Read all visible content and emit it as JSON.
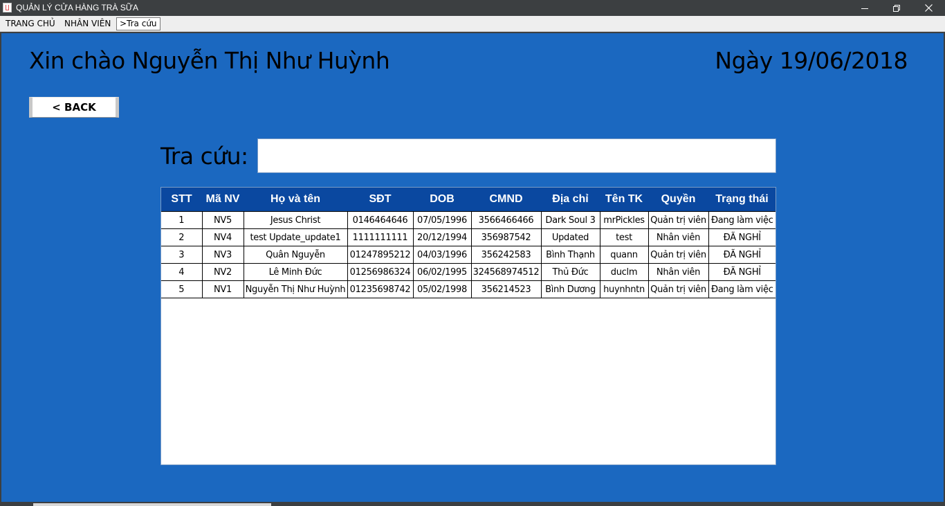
{
  "window": {
    "title": "QUẢN LÝ CỬA HÀNG TRÀ SỮA",
    "icons": [
      "java-app-icon",
      "minimize-icon",
      "restore-icon",
      "close-icon"
    ]
  },
  "menu": {
    "items": [
      {
        "label": "TRANG CHỦ",
        "active": false
      },
      {
        "label": "NHÂN VIÊN",
        "active": false
      },
      {
        "label": ">Tra cứu",
        "active": true
      }
    ]
  },
  "header": {
    "greeting": "Xin chào Nguyễn Thị Như Huỳnh",
    "date": "Ngày 19/06/2018"
  },
  "back_button": {
    "label": "< BACK"
  },
  "search": {
    "label": "Tra cứu:",
    "value": "",
    "placeholder": ""
  },
  "table": {
    "columns": [
      "STT",
      "Mã NV",
      "Họ và tên",
      "SĐT",
      "DOB",
      "CMND",
      "Địa chỉ",
      "Tên TK",
      "Quyền",
      "Trạng thái"
    ],
    "rows": [
      [
        "1",
        "NV5",
        "Jesus Christ",
        "0146464646",
        "07/05/1996",
        "3566466466",
        "Dark Soul 3",
        "mrPickles",
        "Quản trị viên",
        "Đang làm việc"
      ],
      [
        "2",
        "NV4",
        "test Update_update1",
        "1111111111",
        "20/12/1994",
        "356987542",
        "Updated",
        "test",
        "Nhân viên",
        "ĐÃ NGHỈ"
      ],
      [
        "3",
        "NV3",
        "Quân Nguyễn",
        "01247895212",
        "04/03/1996",
        "356242583",
        "Bình Thạnh",
        "quann",
        "Quản trị viên",
        "ĐÃ NGHỈ"
      ],
      [
        "4",
        "NV2",
        "Lê Minh Đức",
        "01256986324",
        "06/02/1995",
        "324568974512",
        "Thủ Đức",
        "duclm",
        "Nhân viên",
        "ĐÃ NGHỈ"
      ],
      [
        "5",
        "NV1",
        "Nguyễn Thị Như Huỳnh",
        "01235698742",
        "05/02/1998",
        "356214523",
        "Bình Dương",
        "huynhntn",
        "Quản trị viên",
        "Đang làm việc"
      ]
    ]
  },
  "colors": {
    "panel_background": "#1b68c0",
    "table_header": "#0a48a0",
    "title_bar": "#3c3f41"
  }
}
